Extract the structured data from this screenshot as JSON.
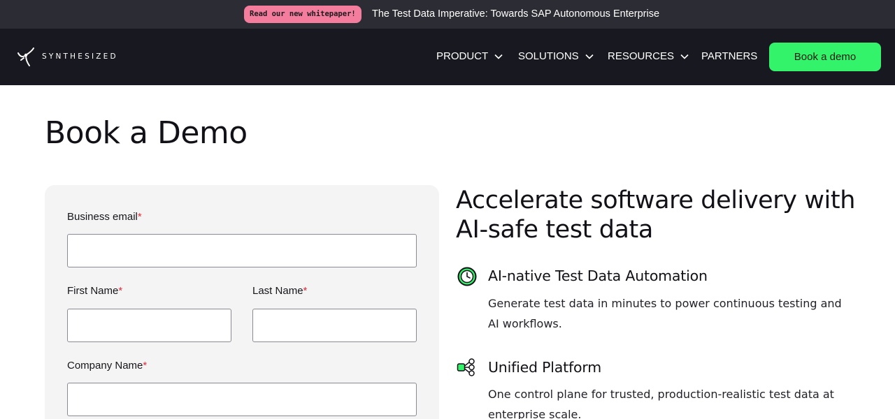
{
  "announcement": {
    "badge": "Read our new whitepaper!",
    "text": "The Test Data Imperative: Towards SAP Autonomous Enterprise"
  },
  "nav": {
    "logo_text": "SYNTHESIZED",
    "items": [
      {
        "label": "PRODUCT",
        "has_dropdown": true
      },
      {
        "label": "SOLUTIONS",
        "has_dropdown": true
      },
      {
        "label": "RESOURCES",
        "has_dropdown": true
      },
      {
        "label": "PARTNERS",
        "has_dropdown": false
      }
    ],
    "cta_label": "Book a demo"
  },
  "page": {
    "title": "Book a Demo"
  },
  "form": {
    "required_marker": "*",
    "fields": {
      "business_email": {
        "label": "Business email",
        "value": "",
        "placeholder": ""
      },
      "first_name": {
        "label": "First Name",
        "value": "",
        "placeholder": ""
      },
      "last_name": {
        "label": "Last Name",
        "value": "",
        "placeholder": ""
      },
      "company_name": {
        "label": "Company Name",
        "value": "",
        "placeholder": ""
      }
    }
  },
  "info": {
    "headline": "Accelerate software delivery with AI-safe test data",
    "features": [
      {
        "icon": "clock-icon",
        "title": "AI-native Test Data Automation",
        "description": "Generate test data in minutes to power continuous testing and AI workflows."
      },
      {
        "icon": "network-nodes-icon",
        "title": "Unified Platform",
        "description": "One control plane for trusted, production-realistic test data at enterprise scale."
      }
    ]
  },
  "colors": {
    "announcement_bg": "#2c2c34",
    "nav_bg": "#181820",
    "badge_pink": "#f47c9c",
    "cta_green": "#33f36b",
    "required_red": "#e02d3c",
    "form_bg": "#f4f4f4"
  }
}
